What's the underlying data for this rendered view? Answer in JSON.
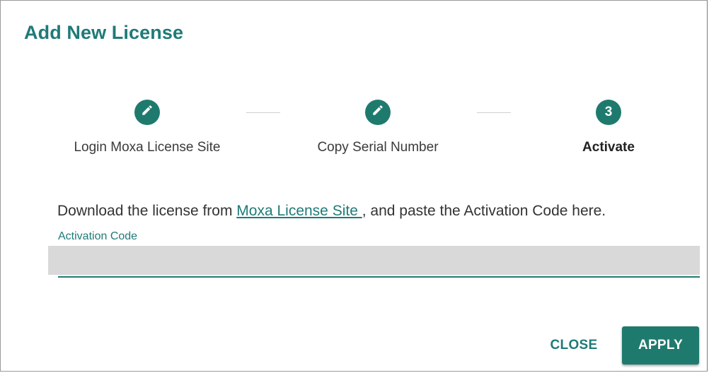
{
  "dialog": {
    "title": "Add New License"
  },
  "stepper": {
    "steps": [
      {
        "label": "Login Moxa License Site",
        "icon": "pencil-icon",
        "state": "completed"
      },
      {
        "label": "Copy Serial Number",
        "icon": "pencil-icon",
        "state": "completed"
      },
      {
        "label": "Activate",
        "number": "3",
        "state": "active"
      }
    ]
  },
  "instruction": {
    "before": "Download the license from ",
    "link": "Moxa License Site ",
    "after": ", and paste the Activation Code here."
  },
  "activation_field": {
    "label": "Activation Code",
    "value": ""
  },
  "actions": {
    "close_label": "CLOSE",
    "apply_label": "APPLY"
  },
  "colors": {
    "accent": "#1f7a78",
    "button_fill": "#1f7a6e",
    "input_fill": "#d9d9d9"
  }
}
